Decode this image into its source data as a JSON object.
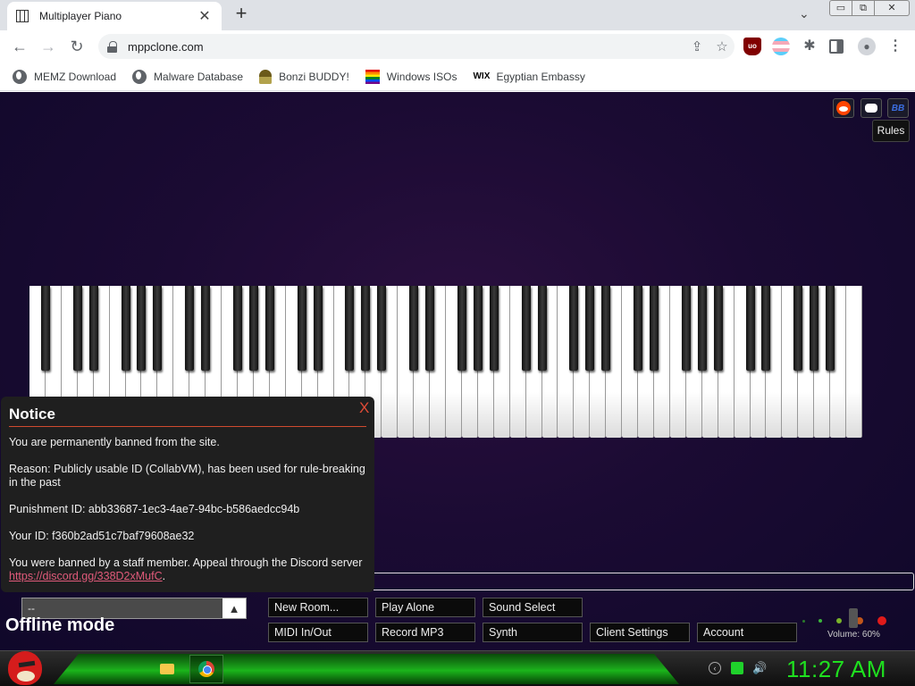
{
  "browser": {
    "tab_title": "Multiplayer Piano",
    "tab_close": "✕",
    "new_tab": "+",
    "tab_list": "⌄",
    "url": "mppclone.com",
    "win_min": "▭",
    "win_max": "⧉",
    "win_close": "✕",
    "nav": {
      "back": "←",
      "forward": "→",
      "reload": "↻"
    },
    "ext_ublock": "uo",
    "menu": "⋮",
    "bookmarks": [
      {
        "label": "MEMZ Download",
        "icon": "globe-icon"
      },
      {
        "label": "Malware Database",
        "icon": "globe-icon"
      },
      {
        "label": "Bonzi BUDDY!",
        "icon": "bonzi-icon"
      },
      {
        "label": "Windows ISOs",
        "icon": "rainbow-icon"
      },
      {
        "label": "Egyptian Embassy",
        "icon": "wix-icon"
      }
    ],
    "wix_text": "WIX"
  },
  "page": {
    "social_bb": "BB",
    "rules": "Rules",
    "notice": {
      "title": "Notice",
      "close": "X",
      "line1": "You are permanently banned from the site.",
      "line2": "Reason: Publicly usable ID (CollabVM), has been used for rule-breaking in the past",
      "line3": "Punishment ID: abb33687-1ec3-4ae7-94bc-b586aedcc94b",
      "line4": "Your ID: f360b2ad51c7baf79608ae32",
      "line5": "You were banned by a staff member. Appeal through the Discord server",
      "link": "https://discord.gg/338D2xMufC",
      "link_suffix": "."
    },
    "channel_value": "--",
    "channel_arrow": "▲",
    "offline_label": "Offline mode",
    "buttons": {
      "new_room": "New Room...",
      "play_alone": "Play Alone",
      "sound_select": "Sound Select",
      "midi": "MIDI In/Out",
      "record": "Record MP3",
      "synth": "Synth",
      "client_settings": "Client Settings",
      "account": "Account"
    },
    "volume_label": "Volume: 60%",
    "volume_level": 0.6
  },
  "taskbar": {
    "clock": "11:27 AM",
    "tray_back": "‹",
    "tray_volume": "🔊"
  },
  "colors": {
    "page_bg": "#1b0b33",
    "notice_accent": "#d04a2f",
    "clock": "#1fe01f"
  }
}
